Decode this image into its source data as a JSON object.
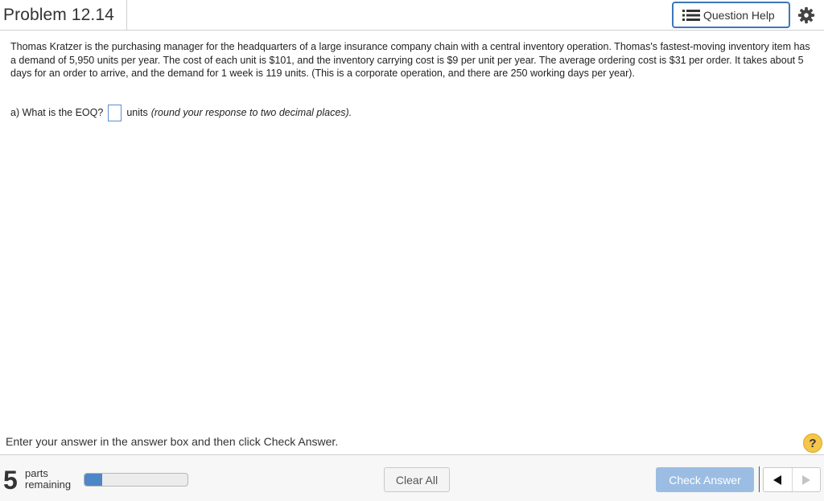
{
  "header": {
    "title": "Problem 12.14",
    "question_help_label": "Question Help"
  },
  "problem": {
    "text": "Thomas Kratzer is the purchasing manager for the headquarters of a large insurance company chain with a central inventory operation. Thomas's fastest-moving inventory item has a demand of 5,950 units per year. The cost of each unit is $101, and the inventory carrying cost is $9 per unit per year. The average ordering cost is $31 per order. It takes about 5 days for an order to arrive, and the demand for 1 week is 119 units. (This is a corporate operation, and there are 250 working days per year).",
    "question_prefix": "a) What is the EOQ?",
    "answer_value": "",
    "units": "units",
    "hint": "(round your response to two decimal places)."
  },
  "instruction": "Enter your answer in the answer box and then click Check Answer.",
  "help_glyph": "?",
  "footer": {
    "parts_count": "5",
    "parts_label_1": "parts",
    "parts_label_2": "remaining",
    "progress_fraction": 0.17,
    "clear_label": "Clear All",
    "check_label": "Check Answer"
  },
  "colors": {
    "accent": "#3d77b8",
    "check_button": "#9cbde3",
    "progress": "#4f86c6",
    "help": "#f5c64a"
  },
  "icons": {
    "question_help": "list-icon",
    "settings": "gear-icon",
    "prev": "triangle-left-icon",
    "next": "triangle-right-icon"
  }
}
